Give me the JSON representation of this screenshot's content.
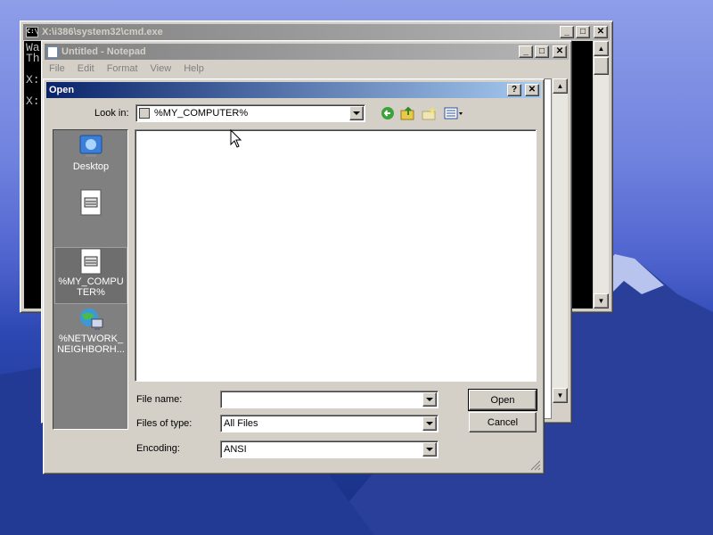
{
  "cmd": {
    "title": "X:\\i386\\system32\\cmd.exe",
    "lines": [
      "Wa",
      "Th",
      "",
      "X:",
      "",
      "X:"
    ]
  },
  "notepad": {
    "title": "Untitled - Notepad",
    "menu": [
      "File",
      "Edit",
      "Format",
      "View",
      "Help"
    ]
  },
  "dialog": {
    "title": "Open",
    "look_in_label": "Look in:",
    "look_in_value": "%MY_COMPUTER%",
    "places": [
      {
        "label": "Desktop",
        "icon": "desktop-icon"
      },
      {
        "label": "",
        "icon": "notepad-doc-icon"
      },
      {
        "label": "%MY_COMPUTER%",
        "icon": "notepad-doc-icon"
      },
      {
        "label": "%NETWORK_NEIGHBORH...",
        "icon": "network-icon"
      }
    ],
    "file_name_label": "File name:",
    "file_name_value": "",
    "files_of_type_label": "Files of type:",
    "files_of_type_value": "All Files",
    "encoding_label": "Encoding:",
    "encoding_value": "ANSI",
    "open_button": "Open",
    "cancel_button": "Cancel"
  },
  "colors": {
    "active_title_start": "#0a246a",
    "active_title_end": "#a6caf0",
    "window_face": "#d4d0c8"
  }
}
